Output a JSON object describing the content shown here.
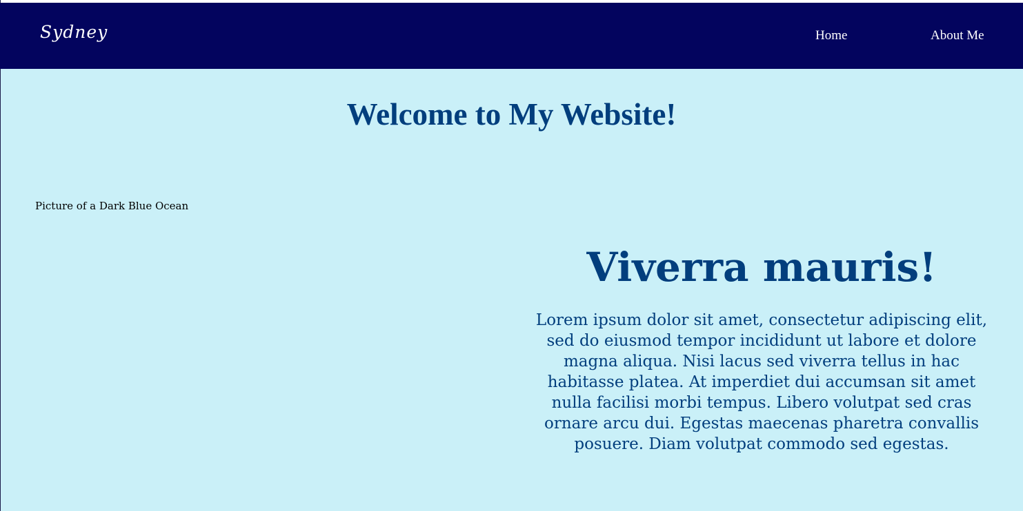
{
  "header": {
    "logo": "Sydney",
    "nav": [
      {
        "label": "Home"
      },
      {
        "label": "About Me"
      }
    ]
  },
  "main": {
    "title": "Welcome to My Website!",
    "image_alt": "Picture of a Dark Blue Ocean",
    "heading": "Viverra mauris!",
    "body": "Lorem ipsum dolor sit amet, consectetur adipiscing elit, sed do eiusmod tempor incididunt ut labore et dolore magna aliqua. Nisi lacus sed viverra tellus in hac habitasse platea. At imperdiet dui accumsan sit amet nulla facilisi morbi tempus. Libero volutpat sed cras ornare arcu dui. Egestas maecenas pharetra convallis posuere. Diam volutpat commodo sed egestas."
  },
  "colors": {
    "navbar": "#03045e",
    "background": "#caf0f8",
    "text_accent": "#023e7d"
  }
}
